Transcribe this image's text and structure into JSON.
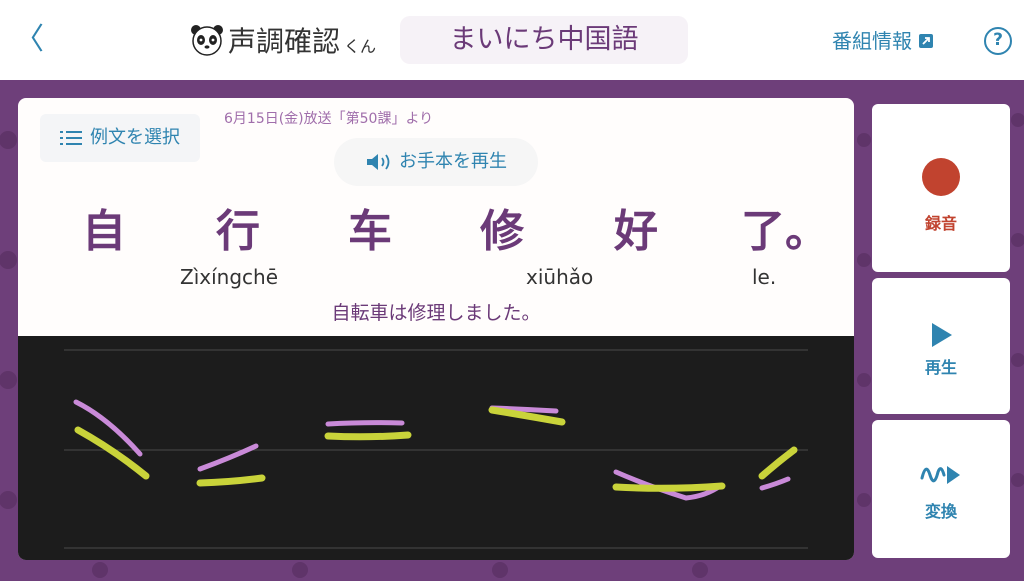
{
  "header": {
    "back_glyph": "〈",
    "logo_title": "声調確認",
    "logo_suffix": "くん",
    "program": "まいにち中国語",
    "info_link": "番組情報",
    "help_glyph": "?"
  },
  "lesson": {
    "select_label": "例文を選択",
    "broadcast": "6月15日(金)放送「第50課」より",
    "play_model_label": "お手本を再生",
    "hanzi": [
      "自",
      "行",
      "车",
      "修",
      "好",
      "了。"
    ],
    "pinyin": [
      "Zìxíngchē",
      "xiūhǎo",
      "le."
    ],
    "translation": "自転車は修理しました。"
  },
  "side": {
    "record_label": "録音",
    "play_label": "再生",
    "convert_label": "変換"
  },
  "colors": {
    "accent_blue": "#2f84b0",
    "purple": "#6b3a78",
    "record_red": "#c1432f",
    "model_curve": "#c98ad8",
    "user_curve": "#c9d33a"
  }
}
